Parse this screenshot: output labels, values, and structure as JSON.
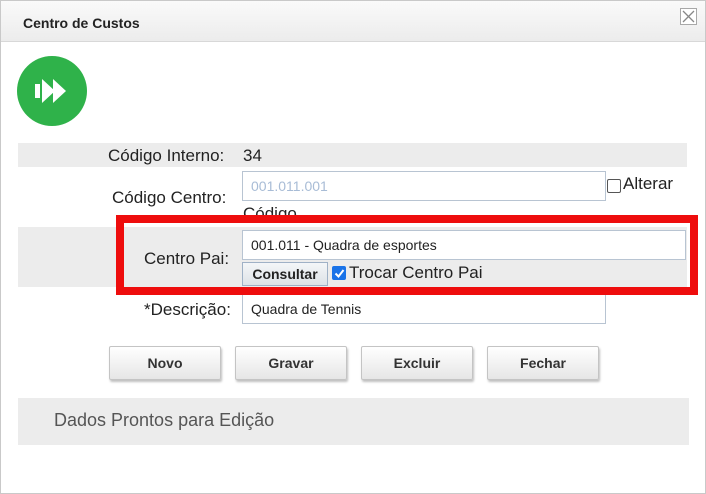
{
  "dialog": {
    "title": "Centro de Custos",
    "close_icon": "close-icon",
    "logo_icon": "fast-forward-icon",
    "brand_color": "#2fb24a"
  },
  "form": {
    "codigo_interno": {
      "label": "Código Interno:",
      "value": "34"
    },
    "codigo_centro": {
      "label": "Código Centro:",
      "value": "001.011.001",
      "checkbox_label": "Alterar",
      "checkbox_label_2": "Código"
    },
    "centro_pai": {
      "label": "Centro Pai:",
      "value": "001.011 - Quadra de esportes",
      "consult_label": "Consultar",
      "checkbox_label": "Trocar Centro Pai"
    },
    "descricao": {
      "label": "*Descrição:",
      "value": "Quadra de Tennis"
    }
  },
  "buttons": {
    "novo": "Novo",
    "gravar": "Gravar",
    "excluir": "Excluir",
    "fechar": "Fechar"
  },
  "status": {
    "text": "Dados Prontos para Edição"
  },
  "highlight_color": "#ee0d0d"
}
